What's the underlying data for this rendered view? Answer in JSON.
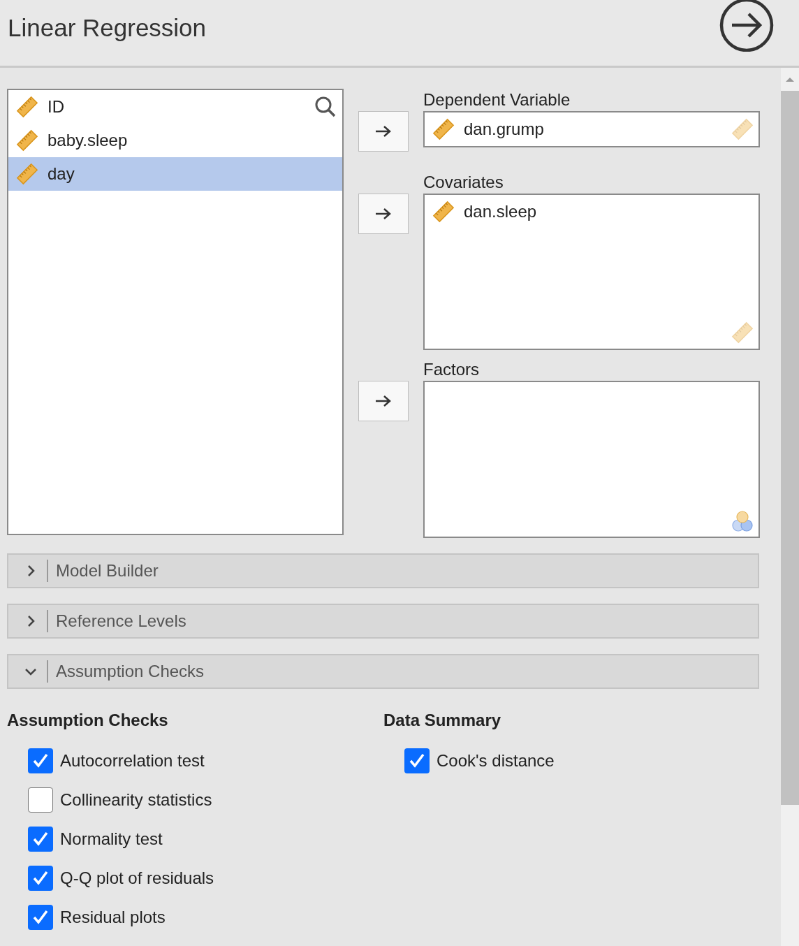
{
  "title": "Linear Regression",
  "variables": [
    {
      "name": "ID",
      "selected": false
    },
    {
      "name": "baby.sleep",
      "selected": false
    },
    {
      "name": "day",
      "selected": true
    }
  ],
  "targets": [
    {
      "label": "Dependent Variable",
      "kind": "continuous",
      "items": [
        "dan.grump"
      ]
    },
    {
      "label": "Covariates",
      "kind": "continuous",
      "items": [
        "dan.sleep"
      ]
    },
    {
      "label": "Factors",
      "kind": "nominal"
    }
  ],
  "sections": [
    {
      "label": "Model Builder",
      "expanded": false
    },
    {
      "label": "Reference Levels",
      "expanded": false
    },
    {
      "label": "Assumption Checks",
      "expanded": true
    }
  ],
  "option_groups": [
    {
      "heading": "Assumption Checks",
      "options": [
        {
          "label": "Autocorrelation test",
          "checked": true
        },
        {
          "label": "Collinearity statistics",
          "checked": false
        },
        {
          "label": "Normality test",
          "checked": true
        },
        {
          "label": "Q-Q plot of residuals",
          "checked": true
        },
        {
          "label": "Residual plots",
          "checked": true
        }
      ]
    },
    {
      "heading": "Data Summary",
      "options": [
        {
          "label": "Cook's distance",
          "checked": true
        }
      ]
    }
  ]
}
